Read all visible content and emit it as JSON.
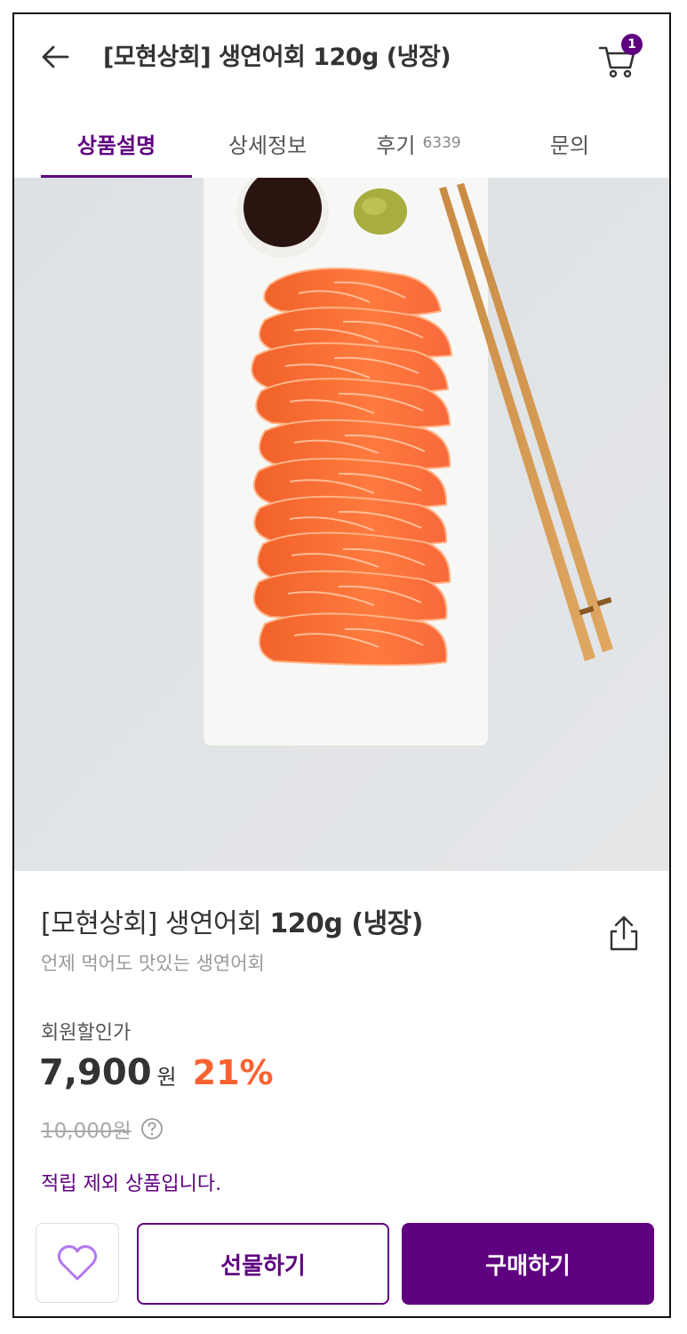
{
  "header": {
    "title": "[모현상회] 생연어회 120g (냉장)",
    "cart_count": "1"
  },
  "tabs": [
    {
      "label": "상품설명",
      "count": ""
    },
    {
      "label": "상세정보",
      "count": ""
    },
    {
      "label": "후기",
      "count": "6339"
    },
    {
      "label": "문의",
      "count": ""
    }
  ],
  "product": {
    "brand": "[모현상회]",
    "name_main": "생연어회",
    "name_bold": "120g (냉장)",
    "subtitle": "언제 먹어도 맛있는 생연어회",
    "price_label": "회원할인가",
    "price": "7,900",
    "currency": "원",
    "discount": "21%",
    "original_price": "10,000원",
    "points_note": "적립 제외 상품입니다."
  },
  "actions": {
    "gift_label": "선물하기",
    "buy_label": "구매하기"
  },
  "colors": {
    "brand": "#5f0080",
    "discount": "#fa622f"
  },
  "icons": [
    "arrow-left-icon",
    "cart-icon",
    "share-icon",
    "help-icon",
    "heart-icon"
  ]
}
